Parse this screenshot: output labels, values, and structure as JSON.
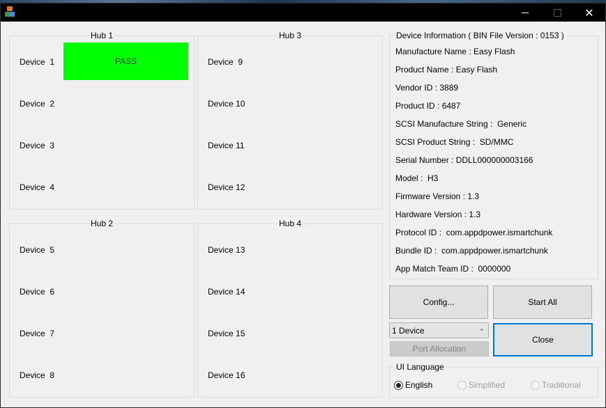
{
  "window": {
    "title": "",
    "controls": {
      "minimize": "—",
      "maximize": "☐",
      "close": "✕"
    }
  },
  "hubs": [
    {
      "title": "Hub 1",
      "devices": [
        {
          "label": "Device  1",
          "status": "PASS",
          "status_color": "#00ff00"
        },
        {
          "label": "Device  2",
          "status": ""
        },
        {
          "label": "Device  3",
          "status": ""
        },
        {
          "label": "Device  4",
          "status": ""
        }
      ]
    },
    {
      "title": "Hub 2",
      "devices": [
        {
          "label": "Device  5",
          "status": ""
        },
        {
          "label": "Device  6",
          "status": ""
        },
        {
          "label": "Device  7",
          "status": ""
        },
        {
          "label": "Device  8",
          "status": ""
        }
      ]
    },
    {
      "title": "Hub 3",
      "devices": [
        {
          "label": "Device  9",
          "status": ""
        },
        {
          "label": "Device 10",
          "status": ""
        },
        {
          "label": "Device 11",
          "status": ""
        },
        {
          "label": "Device 12",
          "status": ""
        }
      ]
    },
    {
      "title": "Hub 4",
      "devices": [
        {
          "label": "Device 13",
          "status": ""
        },
        {
          "label": "Device 14",
          "status": ""
        },
        {
          "label": "Device 15",
          "status": ""
        },
        {
          "label": "Device 16",
          "status": ""
        }
      ]
    }
  ],
  "device_info": {
    "title": "Device Information ( BIN File Version : 0153 )",
    "lines": [
      "Manufacture Name : Easy Flash",
      "Product Name : Easy Flash",
      "Vendor ID : 3889",
      "Product ID : 6487",
      "SCSI Manufacture String :  Generic",
      "SCSI Product String :  SD/MMC",
      "Serial Number : DDLL000000003166",
      "Model :  H3",
      "Firmware Version : 1.3",
      "Hardware Version : 1.3",
      "Protocol ID :  com.appdpower.ismartchunk",
      "Bundle ID :  com.appdpower.ismartchunk",
      "App Match Team ID :  0000000"
    ]
  },
  "buttons": {
    "config": "Config...",
    "start_all": "Start All",
    "close": "Close",
    "port_allocation": "Port Allocation"
  },
  "device_count_select": {
    "value": "1 Device"
  },
  "ui_language": {
    "title": "UI Language",
    "options": [
      {
        "label": "English",
        "selected": true,
        "enabled": true
      },
      {
        "label": "Simplified",
        "selected": false,
        "enabled": false
      },
      {
        "label": "Traditional",
        "selected": false,
        "enabled": false
      }
    ]
  }
}
